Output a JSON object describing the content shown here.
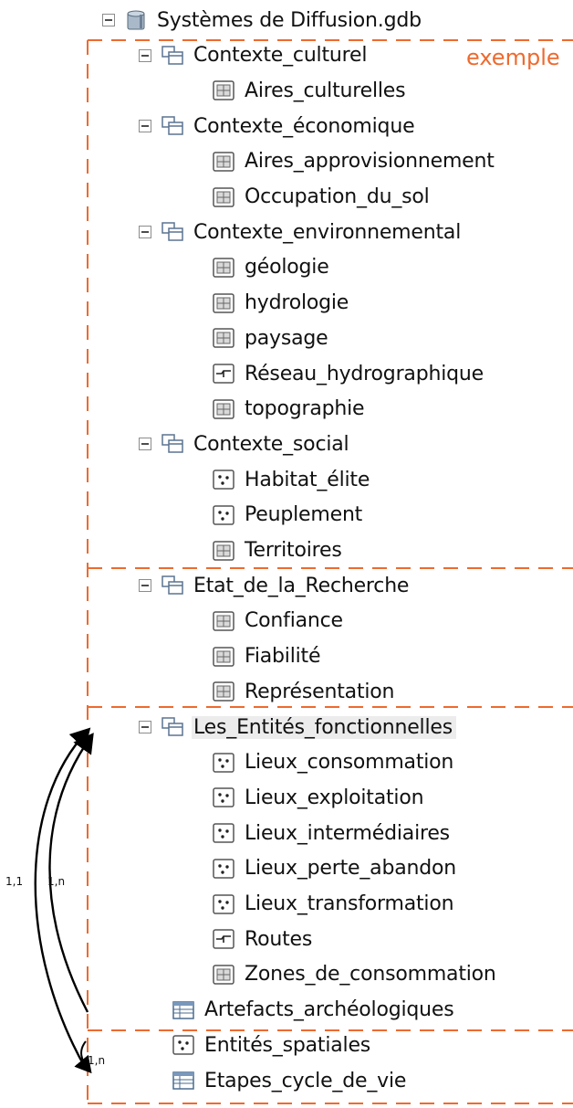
{
  "root": {
    "label": "Systèmes de Diffusion.gdb",
    "icon": "geodatabase-icon"
  },
  "annotation": {
    "tag": "exemple",
    "tag_color": "#ee6a2f",
    "dash_color": "#ee6a2f"
  },
  "cardinality": {
    "left": "1,1",
    "right": "1,n",
    "bottom": "1,n"
  },
  "datasets": [
    {
      "label": "Contexte_culturel",
      "icon": "feature-dataset-icon",
      "children": [
        {
          "label": "Aires_culturelles",
          "icon": "polygon-feature-class-icon"
        }
      ]
    },
    {
      "label": "Contexte_économique",
      "icon": "feature-dataset-icon",
      "children": [
        {
          "label": "Aires_approvisionnement",
          "icon": "polygon-feature-class-icon"
        },
        {
          "label": "Occupation_du_sol",
          "icon": "polygon-feature-class-icon"
        }
      ]
    },
    {
      "label": "Contexte_environnemental",
      "icon": "feature-dataset-icon",
      "children": [
        {
          "label": "géologie",
          "icon": "polygon-feature-class-icon"
        },
        {
          "label": "hydrologie",
          "icon": "polygon-feature-class-icon"
        },
        {
          "label": "paysage",
          "icon": "polygon-feature-class-icon"
        },
        {
          "label": "Réseau_hydrographique",
          "icon": "line-feature-class-icon"
        },
        {
          "label": "topographie",
          "icon": "polygon-feature-class-icon"
        }
      ]
    },
    {
      "label": "Contexte_social",
      "icon": "feature-dataset-icon",
      "children": [
        {
          "label": "Habitat_élite",
          "icon": "point-feature-class-icon"
        },
        {
          "label": "Peuplement",
          "icon": "point-feature-class-icon"
        },
        {
          "label": "Territoires",
          "icon": "polygon-feature-class-icon"
        }
      ]
    },
    {
      "label": "Etat_de_la_Recherche",
      "icon": "feature-dataset-icon",
      "children": [
        {
          "label": "Confiance",
          "icon": "polygon-feature-class-icon"
        },
        {
          "label": "Fiabilité",
          "icon": "polygon-feature-class-icon"
        },
        {
          "label": "Représentation",
          "icon": "polygon-feature-class-icon"
        }
      ]
    },
    {
      "label": "Les_Entités_fonctionnelles",
      "icon": "feature-dataset-icon",
      "selected": true,
      "children": [
        {
          "label": "Lieux_consommation",
          "icon": "point-feature-class-icon"
        },
        {
          "label": "Lieux_exploitation",
          "icon": "point-feature-class-icon"
        },
        {
          "label": "Lieux_intermédiaires",
          "icon": "point-feature-class-icon"
        },
        {
          "label": "Lieux_perte_abandon",
          "icon": "point-feature-class-icon"
        },
        {
          "label": "Lieux_transformation",
          "icon": "point-feature-class-icon"
        },
        {
          "label": "Routes",
          "icon": "line-feature-class-icon"
        },
        {
          "label": "Zones_de_consommation",
          "icon": "polygon-feature-class-icon"
        }
      ]
    }
  ],
  "standalone": [
    {
      "label": "Artefacts_archéologiques",
      "icon": "table-icon"
    },
    {
      "label": "Entités_spatiales",
      "icon": "point-feature-class-icon"
    },
    {
      "label": "Etapes_cycle_de_vie",
      "icon": "table-icon"
    }
  ]
}
